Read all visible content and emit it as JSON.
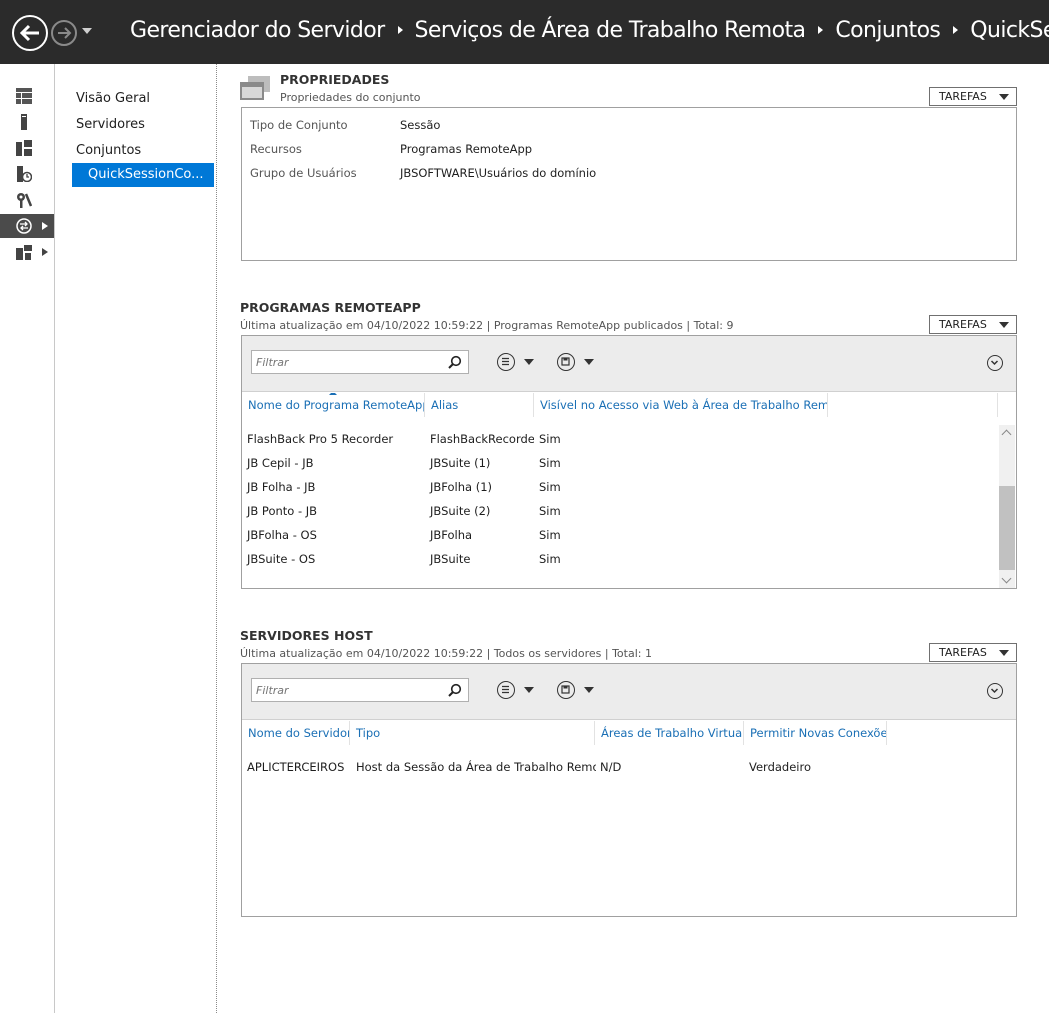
{
  "header": {
    "breadcrumb": [
      "Gerenciador do Servidor",
      "Serviços de Área de Trabalho Remota",
      "Conjuntos",
      "QuickSessio"
    ]
  },
  "rail": {
    "icons": [
      "dashboard-icon",
      "local-server-icon",
      "all-servers-icon",
      "file-storage-icon",
      "tools-icon",
      "remote-desktop-icon",
      "file-services-icon"
    ]
  },
  "nav": {
    "items": [
      "Visão Geral",
      "Servidores",
      "Conjuntos",
      "QuickSessionCo..."
    ]
  },
  "properties": {
    "title": "PROPRIEDADES",
    "subtitle": "Propriedades do conjunto",
    "tasks_label": "TAREFAS",
    "rows": [
      {
        "key": "Tipo de Conjunto",
        "value": "Sessão"
      },
      {
        "key": "Recursos",
        "value": "Programas RemoteApp"
      },
      {
        "key": "Grupo de Usuários",
        "value": "JBSOFTWARE\\Usuários do domínio"
      }
    ]
  },
  "remoteapp": {
    "title": "PROGRAMAS REMOTEAPP",
    "subtitle": "Última atualização em 04/10/2022 10:59:22 | Programas RemoteApp publicados  | Total: 9",
    "tasks_label": "TAREFAS",
    "filter_placeholder": "Filtrar",
    "columns": [
      "Nome do Programa RemoteApp",
      "Alias",
      "Visível no Acesso via Web à Área de Trabalho Remota"
    ],
    "rows": [
      [
        "FlashBack Pro 5 Recorder",
        "FlashBackRecorder",
        "Sim"
      ],
      [
        "JB Cepil - JB",
        "JBSuite (1)",
        "Sim"
      ],
      [
        "JB Folha - JB",
        "JBFolha (1)",
        "Sim"
      ],
      [
        "JB Ponto - JB",
        "JBSuite (2)",
        "Sim"
      ],
      [
        "JBFolha - OS",
        "JBFolha",
        "Sim"
      ],
      [
        "JBSuite - OS",
        "JBSuite",
        "Sim"
      ]
    ]
  },
  "hosts": {
    "title": "SERVIDORES HOST",
    "subtitle": "Última atualização em 04/10/2022 10:59:22 | Todos os servidores  | Total: 1",
    "tasks_label": "TAREFAS",
    "filter_placeholder": "Filtrar",
    "columns": [
      "Nome do Servidor",
      "Tipo",
      "Áreas de Trabalho Virtuais",
      "Permitir Novas Conexões"
    ],
    "rows": [
      [
        "APLICTERCEIROS",
        "Host da Sessão da Área de Trabalho Remota",
        "N/D",
        "Verdadeiro"
      ]
    ]
  }
}
